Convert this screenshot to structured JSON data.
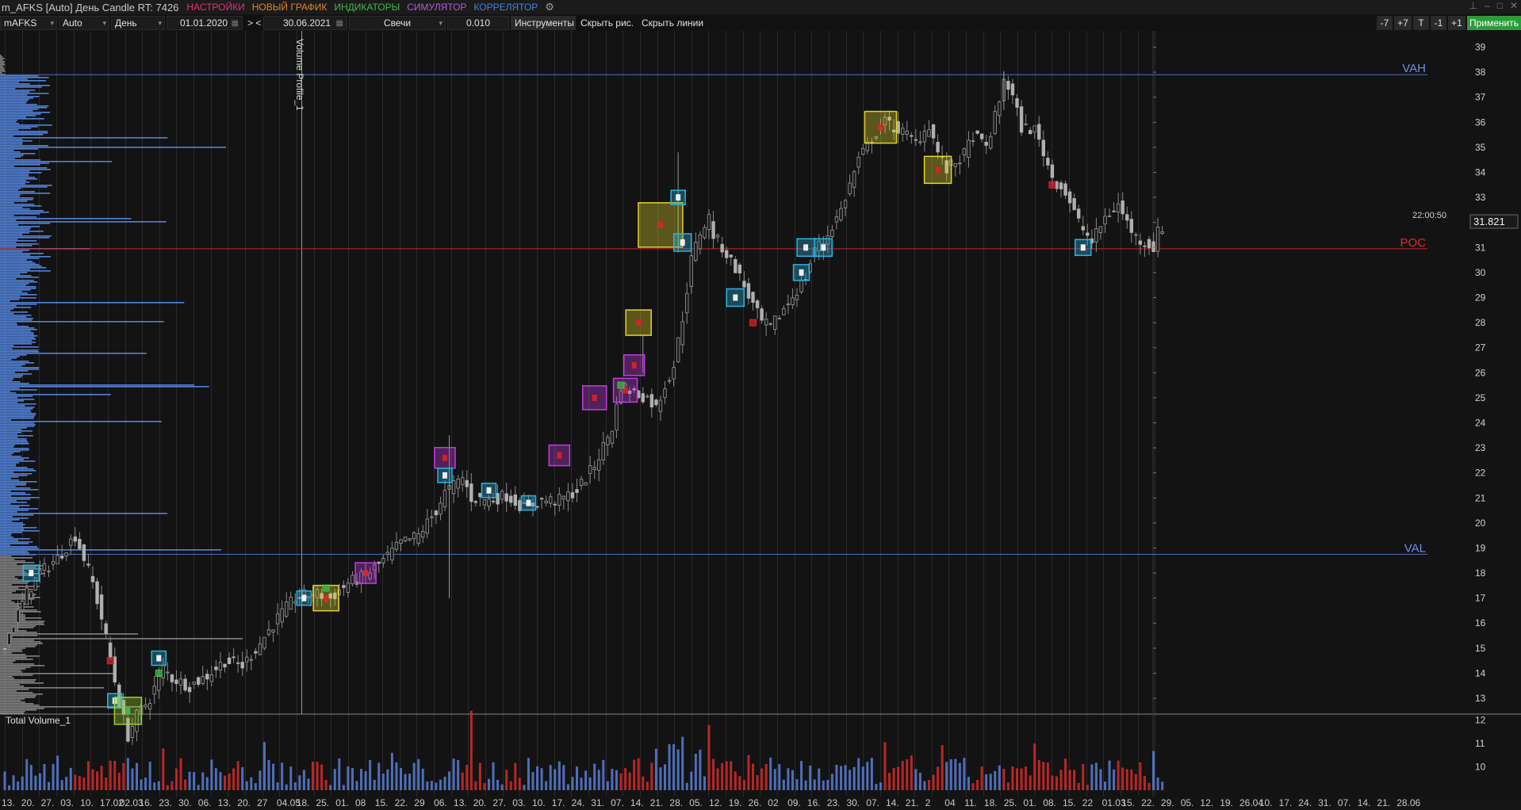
{
  "window": {
    "title": "m_AFKS [Auto] День Candle RT: 7426",
    "menu": [
      {
        "label": "НАСТРОЙКИ",
        "color": "#e0337a"
      },
      {
        "label": "НОВЫЙ ГРАФИК",
        "color": "#e2842a"
      },
      {
        "label": "ИНДИКАТОРЫ",
        "color": "#43b649"
      },
      {
        "label": "СИМУЛЯТОР",
        "color": "#b65ad6"
      },
      {
        "label": "КОРРЕЛЯТОР",
        "color": "#3f86d8"
      }
    ],
    "settings_icon": "gears-icon"
  },
  "toolbar": {
    "symbol": "mAFKS",
    "mode": "Auto",
    "timeframe": "День",
    "date_from": "01.01.2020",
    "nav": "> <",
    "date_to": "30.06.2021",
    "chart_type": "Свечи",
    "step": "0.010",
    "tools": "Инструменты",
    "hide_drawings": "Скрыть рис.",
    "hide_lines": "Скрыть линии",
    "shift_buttons": [
      "-7",
      "+7",
      "T",
      "-1",
      "+1"
    ],
    "apply": "Применить"
  },
  "chart": {
    "volume_profile_label": "Volume Profile_1",
    "total_volume_label": "Total Volume_1",
    "last_price": "31.821",
    "time": "22:00:50",
    "levels": [
      {
        "name": "VAH",
        "value": 37.9,
        "color": "#4f6fbf"
      },
      {
        "name": "POC",
        "value": 30.95,
        "color": "#cc2525"
      },
      {
        "name": "VAL",
        "value": 18.75,
        "color": "#4f6fbf"
      }
    ],
    "price_ticks": [
      39,
      38,
      37,
      36,
      35,
      34,
      33,
      32,
      31,
      30,
      29,
      28,
      27,
      26,
      25,
      24,
      23,
      22,
      21,
      20,
      19,
      18,
      17,
      16,
      15,
      14,
      13
    ],
    "volume_ticks": [
      12,
      11,
      10
    ],
    "date_labels": [
      "13.",
      "20.",
      "27.",
      "03.",
      "10.",
      "17.02",
      "02.03",
      "16.",
      "23.",
      "30.",
      "06.",
      "13.",
      "20.",
      "27",
      "04.05",
      "18.",
      "25.",
      "01.",
      "08",
      "15.",
      "22.",
      "29",
      "06.",
      "13.",
      "20.",
      "27.",
      "03.",
      "10.",
      "17.",
      "24.",
      "31.",
      "07.",
      "14.",
      "21.",
      "28.",
      "05.",
      "12.",
      "19.",
      "26.",
      "02",
      "09.",
      "16.",
      "23.",
      "30.",
      "07.",
      "14.",
      "21.",
      "2",
      "04",
      "11.",
      "18.",
      "25.",
      "01.",
      "08.",
      "15.",
      "22",
      "01.03",
      "15.",
      "22.",
      "29.",
      "05.",
      "12.",
      "19.",
      "26.04",
      "10.",
      "17.",
      "24.",
      "31.",
      "07.",
      "14.",
      "21.",
      "28.06"
    ]
  },
  "chart_data": {
    "type": "candlestick",
    "ylim": [
      12.4,
      39.3
    ],
    "volume_ylim": [
      9,
      12.5
    ],
    "anchors": [
      [
        0,
        15.2
      ],
      [
        5,
        17.2
      ],
      [
        8,
        18.0
      ],
      [
        12,
        18.6
      ],
      [
        16,
        19.5
      ],
      [
        18,
        18.6
      ],
      [
        20,
        17.6
      ],
      [
        22,
        16.2
      ],
      [
        24,
        14.6
      ],
      [
        26,
        12.8
      ],
      [
        28,
        11.5
      ],
      [
        30,
        12.3
      ],
      [
        33,
        13.0
      ],
      [
        36,
        14.2
      ],
      [
        38,
        13.8
      ],
      [
        42,
        13.5
      ],
      [
        46,
        13.9
      ],
      [
        50,
        14.5
      ],
      [
        54,
        14.3
      ],
      [
        58,
        15.2
      ],
      [
        62,
        16.2
      ],
      [
        66,
        17.0
      ],
      [
        70,
        17.2
      ],
      [
        74,
        17.0
      ],
      [
        78,
        17.6
      ],
      [
        82,
        17.9
      ],
      [
        86,
        18.5
      ],
      [
        90,
        19.2
      ],
      [
        94,
        19.5
      ],
      [
        98,
        20.5
      ],
      [
        100,
        21.2
      ],
      [
        102,
        21.5
      ],
      [
        104,
        21.8
      ],
      [
        106,
        21.0
      ],
      [
        110,
        20.9
      ],
      [
        114,
        21.1
      ],
      [
        118,
        20.6
      ],
      [
        122,
        20.9
      ],
      [
        126,
        20.9
      ],
      [
        130,
        21.3
      ],
      [
        134,
        22.3
      ],
      [
        138,
        23.8
      ],
      [
        140,
        25.5
      ],
      [
        143,
        25.2
      ],
      [
        146,
        25.0
      ],
      [
        148,
        24.6
      ],
      [
        150,
        25.5
      ],
      [
        152,
        26.3
      ],
      [
        154,
        28.2
      ],
      [
        156,
        30.5
      ],
      [
        158,
        31.6
      ],
      [
        160,
        32.2
      ],
      [
        161,
        31.5
      ],
      [
        163,
        31.0
      ],
      [
        166,
        30.2
      ],
      [
        170,
        28.7
      ],
      [
        172,
        28.0
      ],
      [
        174,
        27.8
      ],
      [
        178,
        28.8
      ],
      [
        182,
        29.8
      ],
      [
        184,
        31.0
      ],
      [
        186,
        31.2
      ],
      [
        190,
        32.5
      ],
      [
        194,
        34.5
      ],
      [
        198,
        35.6
      ],
      [
        200,
        36.0
      ],
      [
        204,
        35.6
      ],
      [
        207,
        35.2
      ],
      [
        210,
        35.9
      ],
      [
        212,
        34.8
      ],
      [
        214,
        34.1
      ],
      [
        218,
        34.7
      ],
      [
        220,
        35.5
      ],
      [
        223,
        35.0
      ],
      [
        226,
        36.8
      ],
      [
        227,
        37.8
      ],
      [
        229,
        37.0
      ],
      [
        231,
        35.8
      ],
      [
        234,
        35.7
      ],
      [
        236,
        34.8
      ],
      [
        238,
        33.8
      ],
      [
        241,
        33.2
      ],
      [
        244,
        32.0
      ],
      [
        247,
        31.2
      ],
      [
        250,
        32.2
      ],
      [
        253,
        32.7
      ],
      [
        255,
        32.0
      ],
      [
        257,
        31.4
      ],
      [
        259,
        31.2
      ],
      [
        261,
        31.0
      ],
      [
        262,
        31.6
      ],
      [
        263,
        31.8
      ]
    ],
    "signals": [
      {
        "i": 6,
        "p": 18.0,
        "s": 20,
        "c": "#2ab3e0"
      },
      {
        "i": 25,
        "p": 12.9,
        "s": 18,
        "c": "#2ab3e0"
      },
      {
        "i": 28,
        "p": 12.5,
        "s": 34,
        "c": "#9bd22a"
      },
      {
        "i": 35,
        "p": 14.6,
        "s": 18,
        "c": "#2ab3e0"
      },
      {
        "i": 68,
        "p": 17.0,
        "s": 18,
        "c": "#2ab3e0"
      },
      {
        "i": 73,
        "p": 17.0,
        "s": 32,
        "c": "#e2d32a"
      },
      {
        "i": 82,
        "p": 18.0,
        "s": 26,
        "c": "#c23de0"
      },
      {
        "i": 100,
        "p": 22.6,
        "s": 26,
        "c": "#c23de0"
      },
      {
        "i": 100,
        "p": 21.9,
        "s": 18,
        "c": "#2ab3e0"
      },
      {
        "i": 110,
        "p": 21.3,
        "s": 18,
        "c": "#2ab3e0"
      },
      {
        "i": 119,
        "p": 20.8,
        "s": 18,
        "c": "#2ab3e0"
      },
      {
        "i": 126,
        "p": 22.7,
        "s": 26,
        "c": "#c23de0"
      },
      {
        "i": 134,
        "p": 25.0,
        "s": 30,
        "c": "#c23de0"
      },
      {
        "i": 141,
        "p": 25.3,
        "s": 30,
        "c": "#c23de0"
      },
      {
        "i": 143,
        "p": 26.3,
        "s": 26,
        "c": "#c23de0"
      },
      {
        "i": 144,
        "p": 28.0,
        "s": 32,
        "c": "#e2d32a"
      },
      {
        "i": 149,
        "p": 31.9,
        "s": 56,
        "c": "#e2d32a"
      },
      {
        "i": 153,
        "p": 33.0,
        "s": 18,
        "c": "#2ab3e0"
      },
      {
        "i": 154,
        "p": 31.2,
        "s": 22,
        "c": "#2ab3e0"
      },
      {
        "i": 166,
        "p": 29.0,
        "s": 22,
        "c": "#2ab3e0"
      },
      {
        "i": 181,
        "p": 30.0,
        "s": 20,
        "c": "#2ab3e0"
      },
      {
        "i": 182,
        "p": 31.0,
        "s": 22,
        "c": "#2ab3e0"
      },
      {
        "i": 186,
        "p": 31.0,
        "s": 22,
        "c": "#2ab3e0"
      },
      {
        "i": 199,
        "p": 35.8,
        "s": 40,
        "c": "#e2d32a"
      },
      {
        "i": 212,
        "p": 34.1,
        "s": 34,
        "c": "#e2d32a"
      },
      {
        "i": 245,
        "p": 31.0,
        "s": 20,
        "c": "#2ab3e0"
      }
    ]
  }
}
